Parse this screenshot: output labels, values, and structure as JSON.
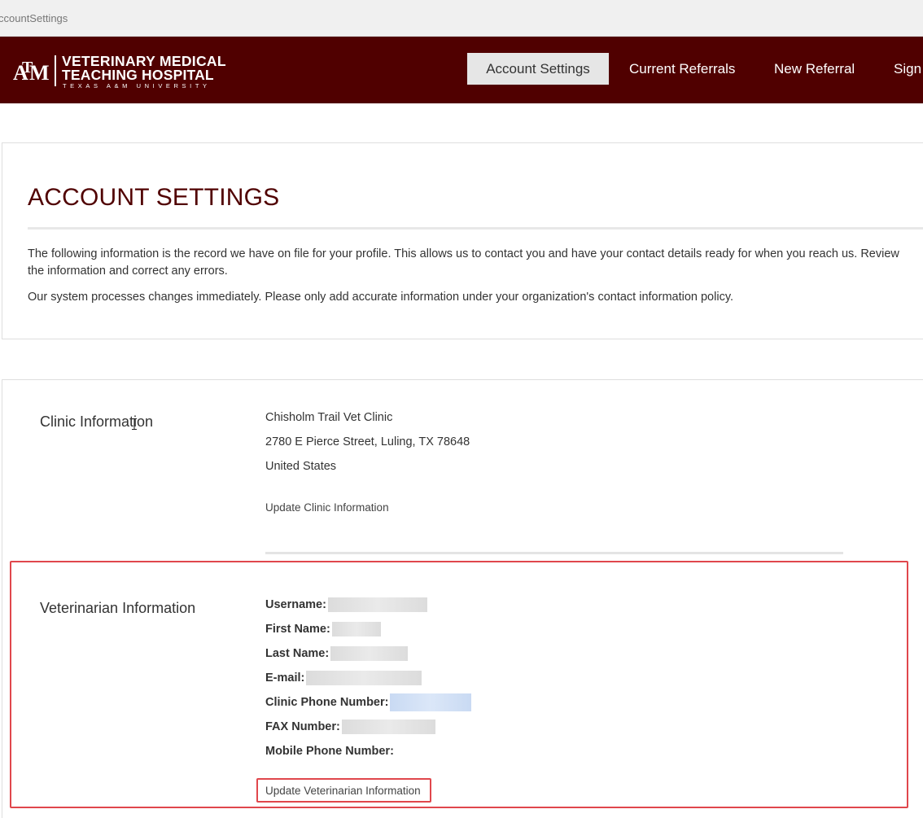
{
  "browser": {
    "address_text": "ccountSettings"
  },
  "header": {
    "logo_mark": "ATM",
    "logo_line1": "VETERINARY MEDICAL",
    "logo_line2": "TEACHING HOSPITAL",
    "logo_line3": "TEXAS A&M UNIVERSITY",
    "nav": [
      {
        "label": "Account Settings",
        "active": true
      },
      {
        "label": "Current Referrals",
        "active": false
      },
      {
        "label": "New Referral",
        "active": false
      },
      {
        "label": "Sign",
        "active": false
      }
    ]
  },
  "page": {
    "title": "ACCOUNT SETTINGS",
    "intro_1": "The following information is the record we have on file for your profile. This allows us to contact you and have your contact details ready for when you reach us. Review the information and correct any errors.",
    "intro_2": "Our system processes changes immediately. Please only add accurate information under your organization's contact information policy."
  },
  "clinic": {
    "label": "Clinic Information",
    "name": "Chisholm Trail Vet Clinic",
    "address": "2780 E Pierce Street, Luling, TX 78648",
    "country": "United States",
    "update_link": "Update Clinic Information"
  },
  "veterinarian": {
    "label": "Veterinarian Information",
    "fields": [
      {
        "label": "Username:"
      },
      {
        "label": "First Name:"
      },
      {
        "label": "Last Name:"
      },
      {
        "label": "E-mail:"
      },
      {
        "label": "Clinic Phone Number:"
      },
      {
        "label": "FAX Number:"
      },
      {
        "label": "Mobile Phone Number:"
      }
    ],
    "update_link": "Update Veterinarian Information"
  },
  "colors": {
    "brand_maroon": "#500000",
    "highlight_red": "#e0474c",
    "active_nav_bg": "#e6e6e6"
  }
}
